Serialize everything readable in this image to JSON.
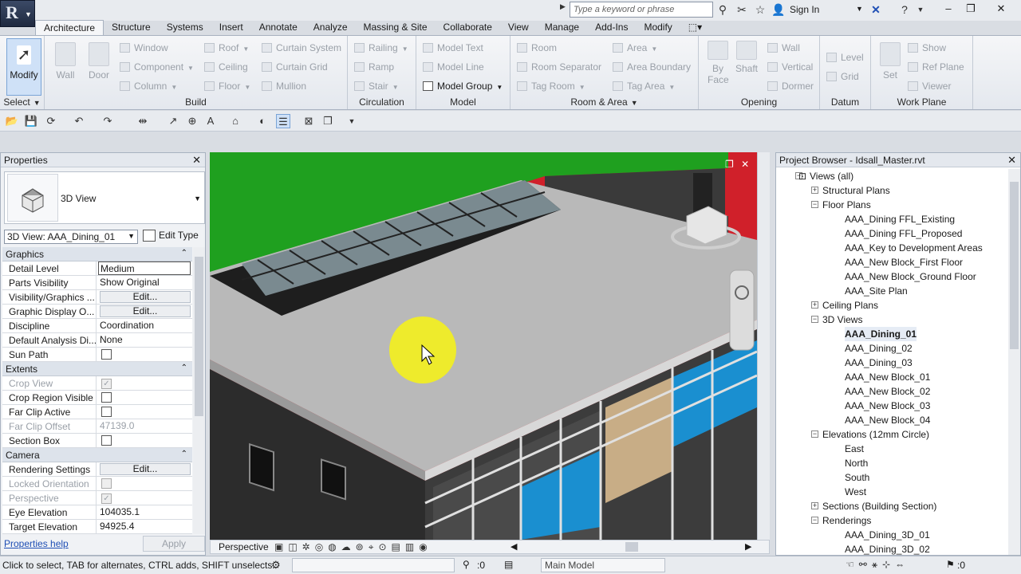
{
  "app": {
    "logo": "R"
  },
  "search": {
    "placeholder": "Type a keyword or phrase"
  },
  "account": {
    "signin": "Sign In"
  },
  "tabs": [
    "Architecture",
    "Structure",
    "Systems",
    "Insert",
    "Annotate",
    "Analyze",
    "Massing & Site",
    "Collaborate",
    "View",
    "Manage",
    "Add-Ins",
    "Modify"
  ],
  "ribbon": {
    "modify": "Modify",
    "select": "Select",
    "build": {
      "label": "Build",
      "wall": "Wall",
      "door": "Door",
      "window": "Window",
      "component": "Component",
      "column": "Column",
      "roof": "Roof",
      "ceiling": "Ceiling",
      "floor": "Floor",
      "curtain_system": "Curtain System",
      "curtain_grid": "Curtain Grid",
      "mullion": "Mullion"
    },
    "circulation": {
      "label": "Circulation",
      "railing": "Railing",
      "ramp": "Ramp",
      "stair": "Stair"
    },
    "model": {
      "label": "Model",
      "model_text": "Model Text",
      "model_line": "Model Line",
      "model_group": "Model Group"
    },
    "room_area": {
      "label": "Room & Area",
      "room": "Room",
      "room_separator": "Room Separator",
      "tag_room": "Tag Room",
      "area": "Area",
      "area_boundary": "Area Boundary",
      "tag_area": "Tag Area"
    },
    "opening": {
      "label": "Opening",
      "by_face": "By Face",
      "shaft": "Shaft",
      "wall": "Wall",
      "vertical": "Vertical",
      "dormer": "Dormer"
    },
    "datum": {
      "label": "Datum",
      "level": "Level",
      "grid": "Grid"
    },
    "work_plane": {
      "label": "Work Plane",
      "set": "Set",
      "show": "Show",
      "ref_plane": "Ref Plane",
      "viewer": "Viewer"
    }
  },
  "properties": {
    "title": "Properties",
    "type_name": "3D View",
    "instance": "3D View: AAA_Dining_01",
    "edit_type": "Edit Type",
    "help": "Properties help",
    "apply": "Apply",
    "groups": {
      "graphics": "Graphics",
      "extents": "Extents",
      "camera": "Camera"
    },
    "rows": {
      "detail_level": {
        "k": "Detail Level",
        "v": "Medium"
      },
      "parts_visibility": {
        "k": "Parts Visibility",
        "v": "Show Original"
      },
      "vis_graphics": {
        "k": "Visibility/Graphics ...",
        "v": "Edit..."
      },
      "graphic_display": {
        "k": "Graphic Display O...",
        "v": "Edit..."
      },
      "discipline": {
        "k": "Discipline",
        "v": "Coordination"
      },
      "analysis": {
        "k": "Default Analysis Di...",
        "v": "None"
      },
      "sun_path": {
        "k": "Sun Path",
        "v": false
      },
      "crop_view": {
        "k": "Crop View",
        "v": true
      },
      "crop_region": {
        "k": "Crop Region Visible",
        "v": false
      },
      "far_clip_active": {
        "k": "Far Clip Active",
        "v": false
      },
      "far_clip_offset": {
        "k": "Far Clip Offset",
        "v": "47139.0"
      },
      "section_box": {
        "k": "Section Box",
        "v": false
      },
      "rendering": {
        "k": "Rendering Settings",
        "v": "Edit..."
      },
      "locked_orientation": {
        "k": "Locked Orientation",
        "v": false
      },
      "perspective": {
        "k": "Perspective",
        "v": true
      },
      "eye_elevation": {
        "k": "Eye Elevation",
        "v": "104035.1"
      },
      "target_elevation": {
        "k": "Target Elevation",
        "v": "94925.4"
      }
    }
  },
  "viewport": {
    "view_mode": "Perspective"
  },
  "browser": {
    "title": "Project Browser - Idsall_Master.rvt",
    "nodes": [
      {
        "label": "Views (all)",
        "level": 0,
        "expanded": true
      },
      {
        "label": "Structural Plans",
        "level": 1,
        "expanded": false
      },
      {
        "label": "Floor Plans",
        "level": 1,
        "expanded": true
      },
      {
        "label": "AAA_Dining FFL_Existing",
        "level": 2
      },
      {
        "label": "AAA_Dining FFL_Proposed",
        "level": 2
      },
      {
        "label": "AAA_Key to Development Areas",
        "level": 2
      },
      {
        "label": "AAA_New Block_First Floor",
        "level": 2
      },
      {
        "label": "AAA_New Block_Ground Floor",
        "level": 2
      },
      {
        "label": "AAA_Site Plan",
        "level": 2
      },
      {
        "label": "Ceiling Plans",
        "level": 1,
        "expanded": false
      },
      {
        "label": "3D Views",
        "level": 1,
        "expanded": true
      },
      {
        "label": "AAA_Dining_01",
        "level": 2,
        "selected": true
      },
      {
        "label": "AAA_Dining_02",
        "level": 2
      },
      {
        "label": "AAA_Dining_03",
        "level": 2
      },
      {
        "label": "AAA_New Block_01",
        "level": 2
      },
      {
        "label": "AAA_New Block_02",
        "level": 2
      },
      {
        "label": "AAA_New Block_03",
        "level": 2
      },
      {
        "label": "AAA_New Block_04",
        "level": 2
      },
      {
        "label": "Elevations (12mm Circle)",
        "level": 1,
        "expanded": true
      },
      {
        "label": "East",
        "level": 2
      },
      {
        "label": "North",
        "level": 2
      },
      {
        "label": "South",
        "level": 2
      },
      {
        "label": "West",
        "level": 2
      },
      {
        "label": "Sections (Building Section)",
        "level": 1,
        "expanded": false
      },
      {
        "label": "Renderings",
        "level": 1,
        "expanded": true
      },
      {
        "label": "AAA_Dining_3D_01",
        "level": 2
      },
      {
        "label": "AAA_Dining_3D_02",
        "level": 2
      }
    ]
  },
  "status": {
    "hint": "Click to select, TAB for alternates, CTRL adds, SHIFT unselects.",
    "count": ":0",
    "model": "Main Model",
    "filter": ":0"
  },
  "colors": {
    "accent": "#7aa4d6",
    "sky": "#1fa01f",
    "roof": "#b7b7b7",
    "glass": "#1a8fd0",
    "ground": "#d0202a"
  }
}
